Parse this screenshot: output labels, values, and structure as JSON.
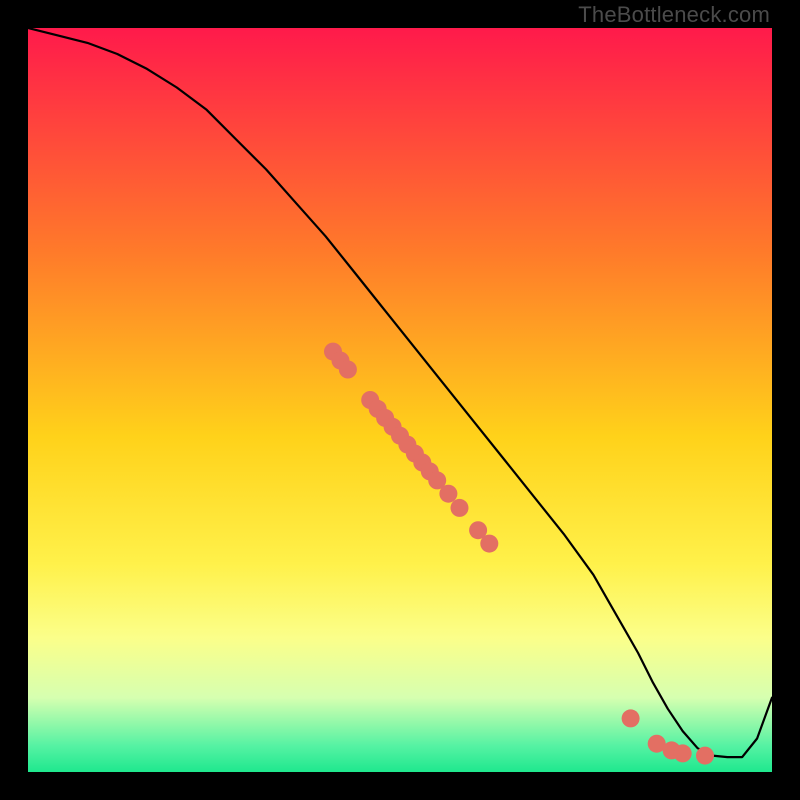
{
  "watermark": "TheBottleneck.com",
  "chart_data": {
    "type": "line",
    "title": "",
    "xlabel": "",
    "ylabel": "",
    "xlim": [
      0,
      100
    ],
    "ylim": [
      0,
      100
    ],
    "legend": false,
    "grid": false,
    "background_gradient": {
      "stops": [
        {
          "offset": 0.0,
          "color": "#ff1a4b"
        },
        {
          "offset": 0.3,
          "color": "#ff7a2a"
        },
        {
          "offset": 0.55,
          "color": "#ffd21a"
        },
        {
          "offset": 0.72,
          "color": "#fff14a"
        },
        {
          "offset": 0.82,
          "color": "#fbff8a"
        },
        {
          "offset": 0.9,
          "color": "#d6ffb0"
        },
        {
          "offset": 0.965,
          "color": "#55f2a3"
        },
        {
          "offset": 1.0,
          "color": "#1fe88e"
        }
      ]
    },
    "series": [
      {
        "name": "bottleneck-curve",
        "x": [
          0,
          4,
          8,
          12,
          16,
          20,
          24,
          28,
          32,
          36,
          40,
          44,
          48,
          52,
          56,
          60,
          64,
          68,
          72,
          76,
          78,
          80,
          82,
          84,
          86,
          88,
          90,
          92,
          94,
          96,
          98,
          100
        ],
        "y": [
          100,
          99,
          98,
          96.5,
          94.5,
          92,
          89,
          85,
          81,
          76.5,
          72,
          67,
          62,
          57,
          52,
          47,
          42,
          37,
          32,
          26.5,
          23,
          19.5,
          16,
          12,
          8.5,
          5.5,
          3.2,
          2.2,
          2.0,
          2.0,
          4.5,
          10
        ]
      }
    ],
    "markers": {
      "name": "highlighted-points",
      "color": "#e36f63",
      "radius": 9,
      "points": [
        {
          "x": 41,
          "y": 56.5
        },
        {
          "x": 42,
          "y": 55.3
        },
        {
          "x": 43,
          "y": 54.1
        },
        {
          "x": 46,
          "y": 50.0
        },
        {
          "x": 47,
          "y": 48.8
        },
        {
          "x": 48,
          "y": 47.6
        },
        {
          "x": 49,
          "y": 46.4
        },
        {
          "x": 50,
          "y": 45.2
        },
        {
          "x": 51,
          "y": 44.0
        },
        {
          "x": 52,
          "y": 42.8
        },
        {
          "x": 53,
          "y": 41.6
        },
        {
          "x": 54,
          "y": 40.4
        },
        {
          "x": 55,
          "y": 39.2
        },
        {
          "x": 56.5,
          "y": 37.4
        },
        {
          "x": 58,
          "y": 35.5
        },
        {
          "x": 60.5,
          "y": 32.5
        },
        {
          "x": 62,
          "y": 30.7
        },
        {
          "x": 81,
          "y": 7.2
        },
        {
          "x": 84.5,
          "y": 3.8
        },
        {
          "x": 86.5,
          "y": 2.9
        },
        {
          "x": 88,
          "y": 2.5
        },
        {
          "x": 91,
          "y": 2.2
        }
      ]
    }
  }
}
